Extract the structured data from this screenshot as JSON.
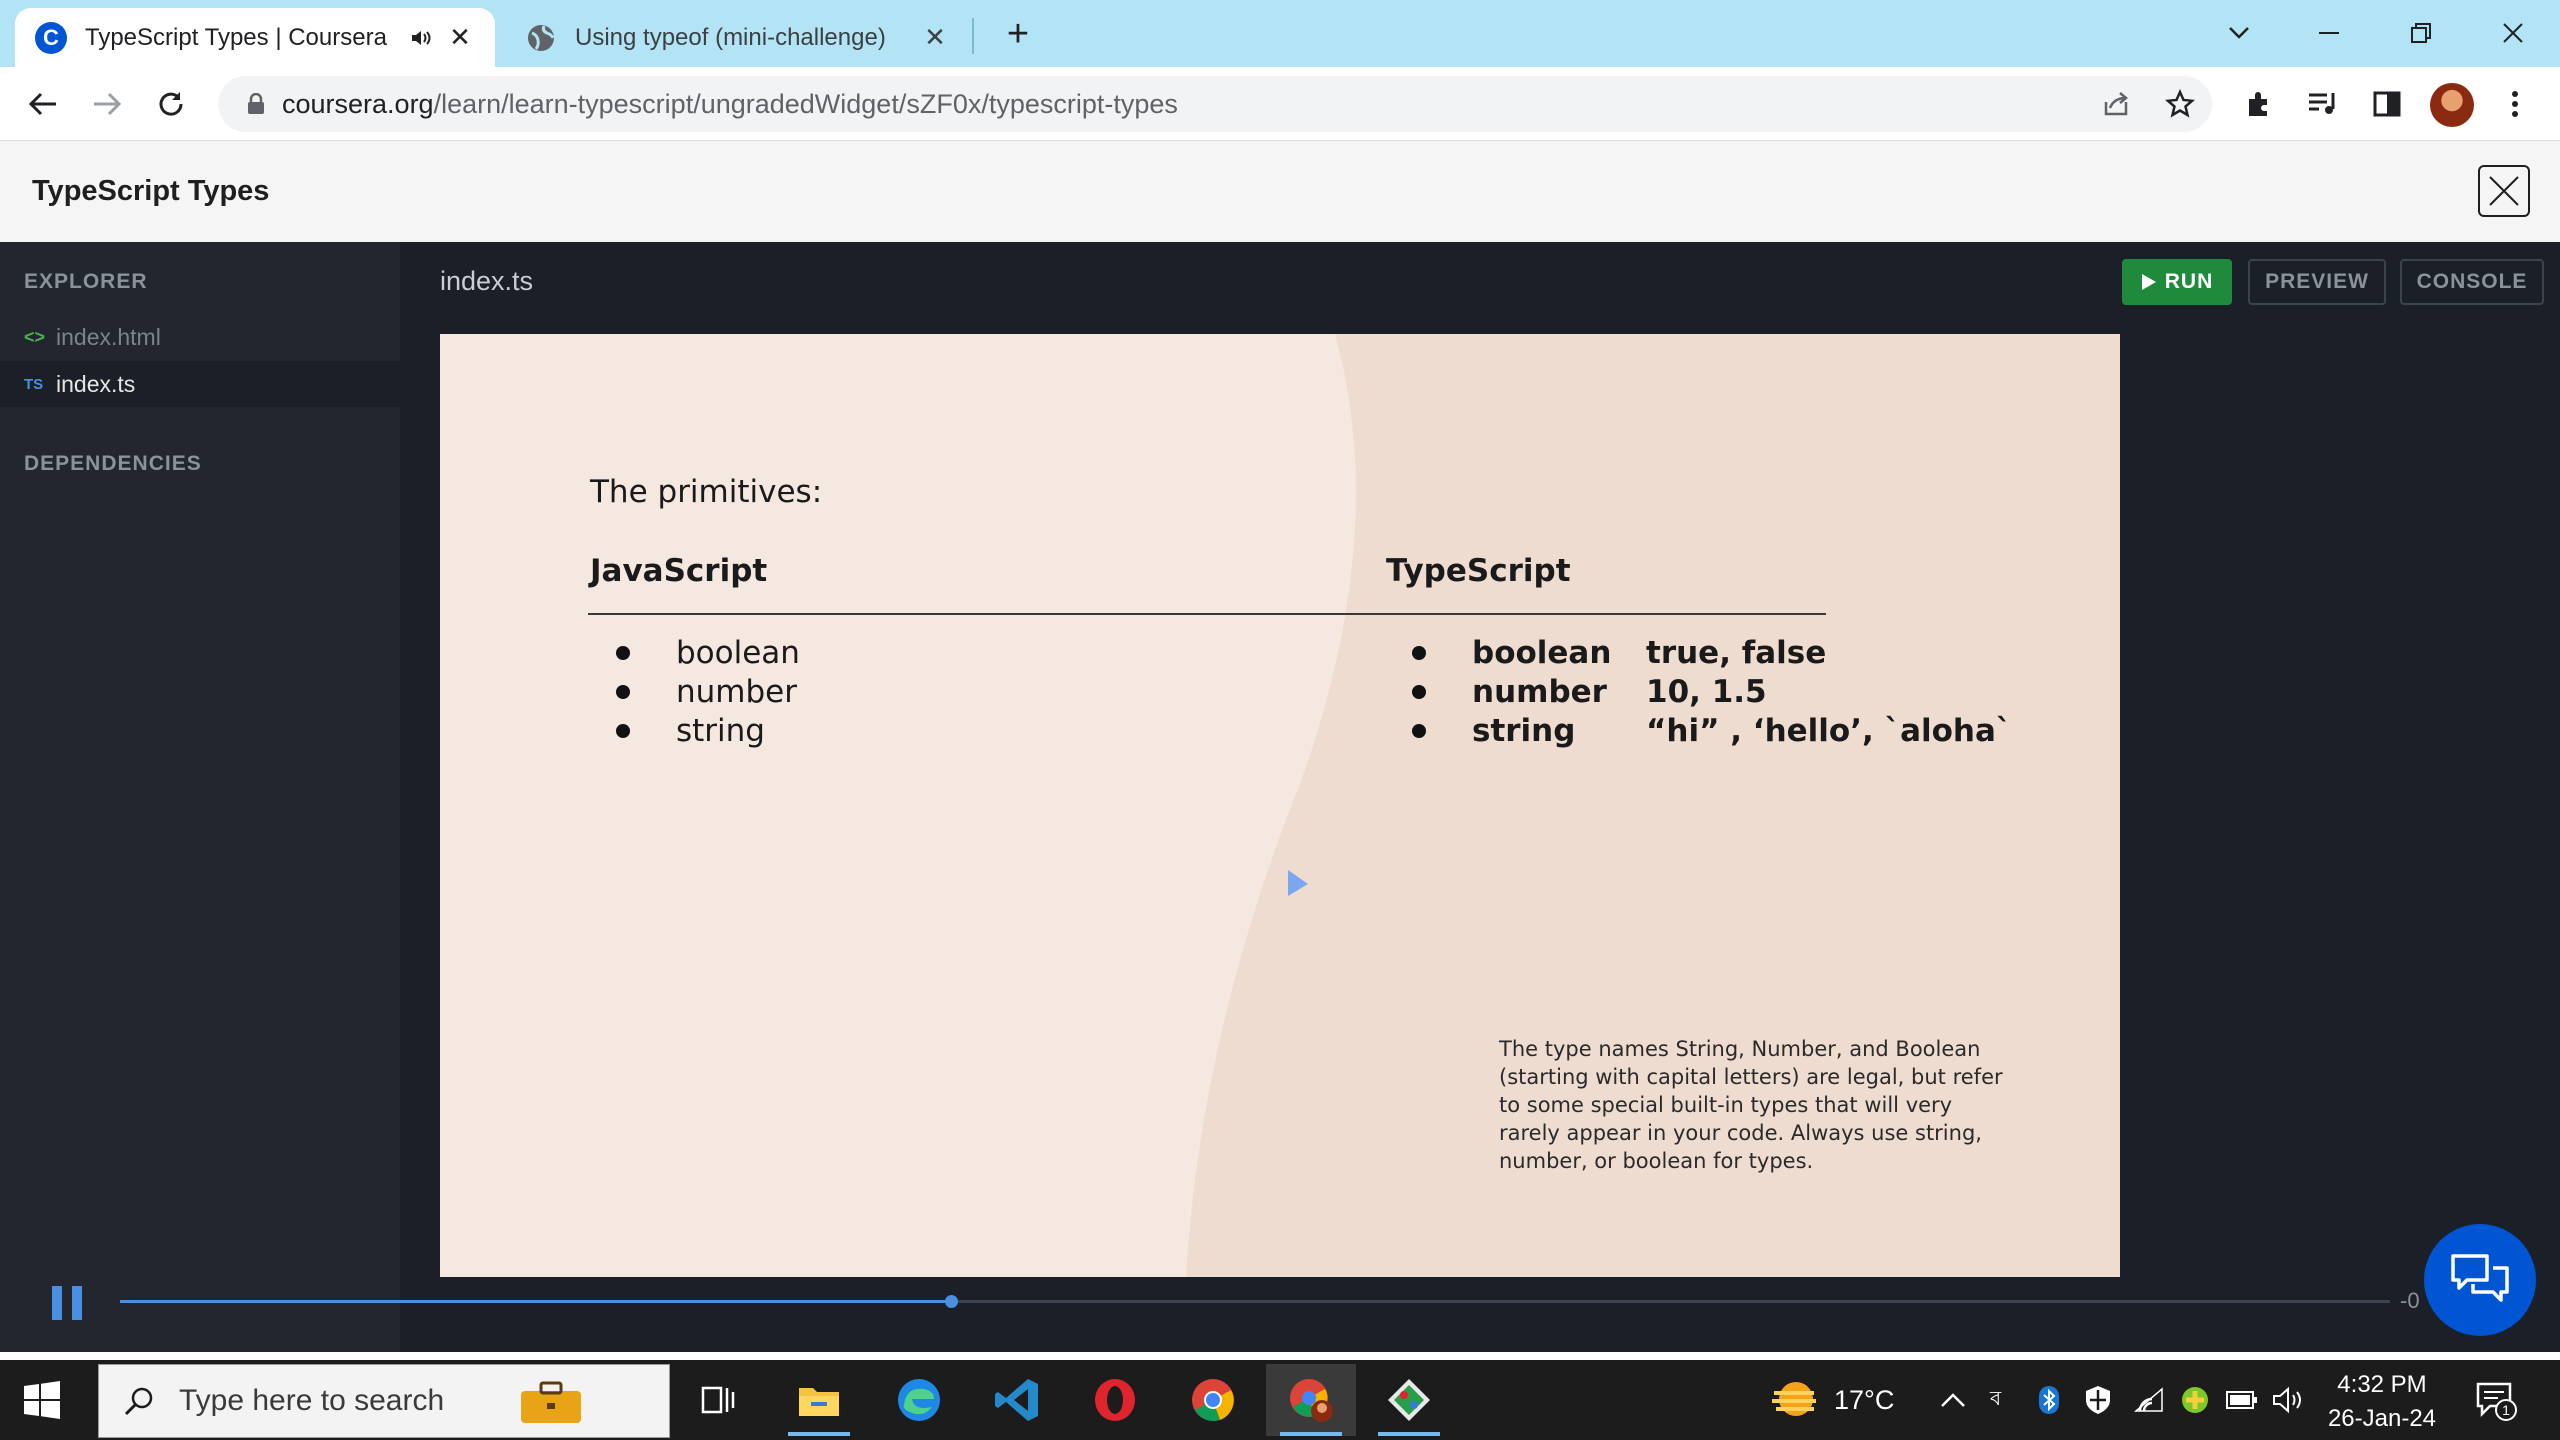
{
  "browser": {
    "tabs": [
      {
        "title": "TypeScript Types | Coursera",
        "active": true,
        "favicon": "coursera-icon",
        "audio": true
      },
      {
        "title": "Using typeof (mini-challenge)",
        "active": false,
        "favicon": "globe-icon"
      }
    ],
    "url_domain": "coursera.org",
    "url_path": "/learn/learn-typescript/ungradedWidget/sZF0x/typescript-types"
  },
  "header": {
    "title": "TypeScript Types"
  },
  "ide": {
    "sidebar": {
      "explorer_heading": "EXPLORER",
      "files": [
        {
          "icon": "<>",
          "name": "index.html"
        },
        {
          "icon": "TS",
          "name": "index.ts"
        }
      ],
      "dependencies_heading": "DEPENDENCIES"
    },
    "open_file": "index.ts",
    "buttons": {
      "run": "RUN",
      "preview": "PREVIEW",
      "console": "CONSOLE"
    }
  },
  "slide": {
    "heading": "The primitives:",
    "js_heading": "JavaScript",
    "ts_heading": "TypeScript",
    "js_items": [
      "boolean",
      "number",
      "string"
    ],
    "ts_items": [
      {
        "type": "boolean",
        "example": "true, false"
      },
      {
        "type": "number",
        "example": "10, 1.5"
      },
      {
        "type": "string",
        "example": "“hi” , ‘hello’, `aloha`"
      }
    ],
    "note": "The type names String, Number, and Boolean (starting with capital letters) are legal, but refer to some special built-in types that will very rarely appear in your code. Always use string, number, or boolean for types."
  },
  "player": {
    "progress": 0.366,
    "time_remaining": "-0"
  },
  "taskbar": {
    "search_placeholder": "Type here to search",
    "weather": "17°C",
    "time": "4:32 PM",
    "date": "26-Jan-24",
    "notification_count": "1"
  },
  "colors": {
    "accent": "#4a90e2",
    "run_green": "#1f8a3c",
    "coursera_blue": "#0056d2",
    "slide_bg": "#f4e8e0"
  }
}
